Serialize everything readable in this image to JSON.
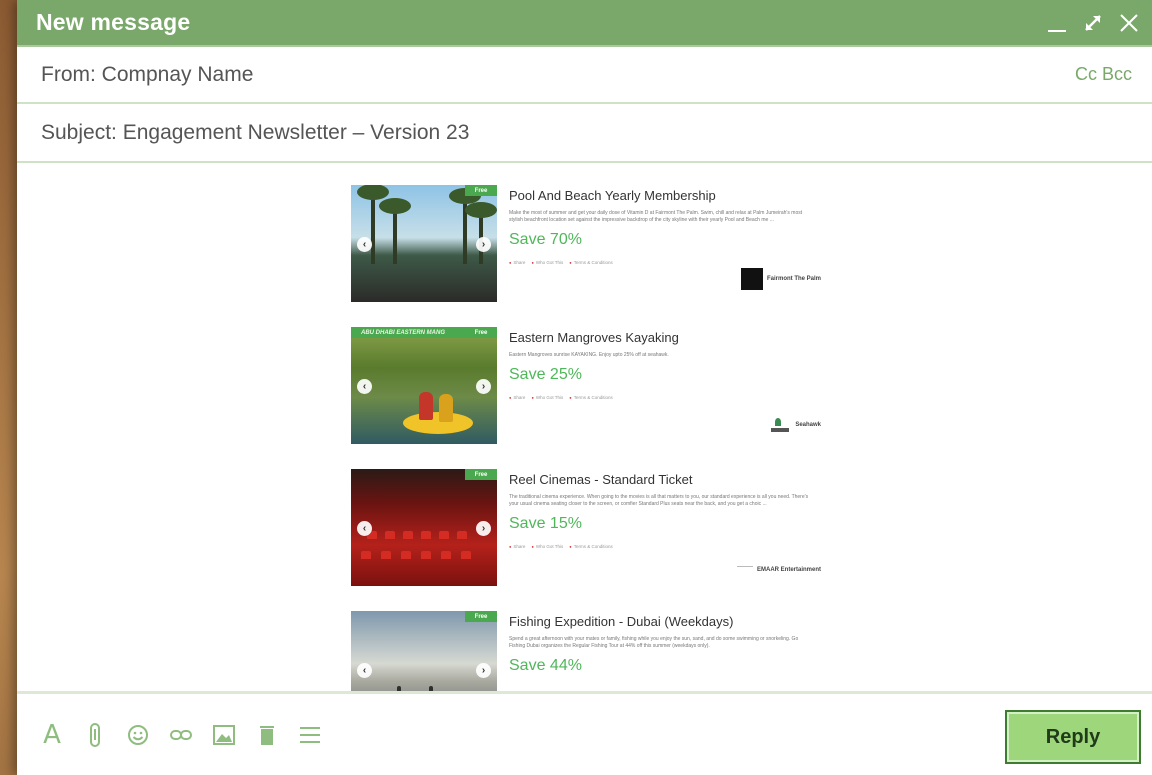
{
  "window": {
    "title": "New message",
    "controls": {
      "minimize_icon": "minimize-icon",
      "expand_icon": "expand-icon",
      "close_icon": "close-icon"
    }
  },
  "header": {
    "from": "From: Compnay Name",
    "cc_label": "Cc",
    "bcc_label": "Bcc",
    "subject": "Subject: Engagement Newsletter – Version 23"
  },
  "newsletter": {
    "free_tag": "Free",
    "actions": [
      "Share",
      "Who Got This",
      "Terms & Conditions"
    ],
    "deals": [
      {
        "title": "Pool And Beach Yearly Membership",
        "description": "Make the most of summer and get your daily dose of Vitamin D at Fairmont The Palm. Swim, chill and relax at Palm Jumeirah's most stylish beachfront location set against the impressive backdrop of the city skyline with their yearly Pool and Beach me ...",
        "save": "Save 70%",
        "merchant": "Fairmont The Palm"
      },
      {
        "banner": "ABU DHABI EASTERN MANG",
        "title": "Eastern Mangroves Kayaking",
        "description": "Eastern Mangroves sunrise KAYAKING. Enjoy upto 25% off at seahawk.",
        "save": "Save 25%",
        "merchant": "Seahawk"
      },
      {
        "title": "Reel Cinemas - Standard Ticket",
        "description": "The traditional cinema experience. When going to the movies is all that matters to you, our standard experience is all you need. There's your usual cinema seating closer to the screen, or comfier Standard Plus seats near the back, and you get a choic ...",
        "save": "Save 15%",
        "merchant": "EMAAR Entertainment"
      },
      {
        "title": "Fishing Expedition - Dubai (Weekdays)",
        "description": "Spend a great afternoon with your mates or family, fishing while you enjoy the sun, sand, and do some swimming or snorkeling. Go Fishing Dubai organizes the Regular Fishing Tour at 44% off this summer (weekdays only).",
        "save": "Save 44%",
        "merchant": ""
      }
    ]
  },
  "toolbar": {
    "icons": [
      "text-format-icon",
      "attachment-icon",
      "emoji-icon",
      "link-icon",
      "image-icon",
      "trash-icon",
      "menu-icon"
    ],
    "format_glyph": "A",
    "reply_label": "Reply"
  },
  "colors": {
    "accent": "#7aa86a",
    "save_green": "#4fb75a",
    "reply_bg": "#9dd67b"
  }
}
